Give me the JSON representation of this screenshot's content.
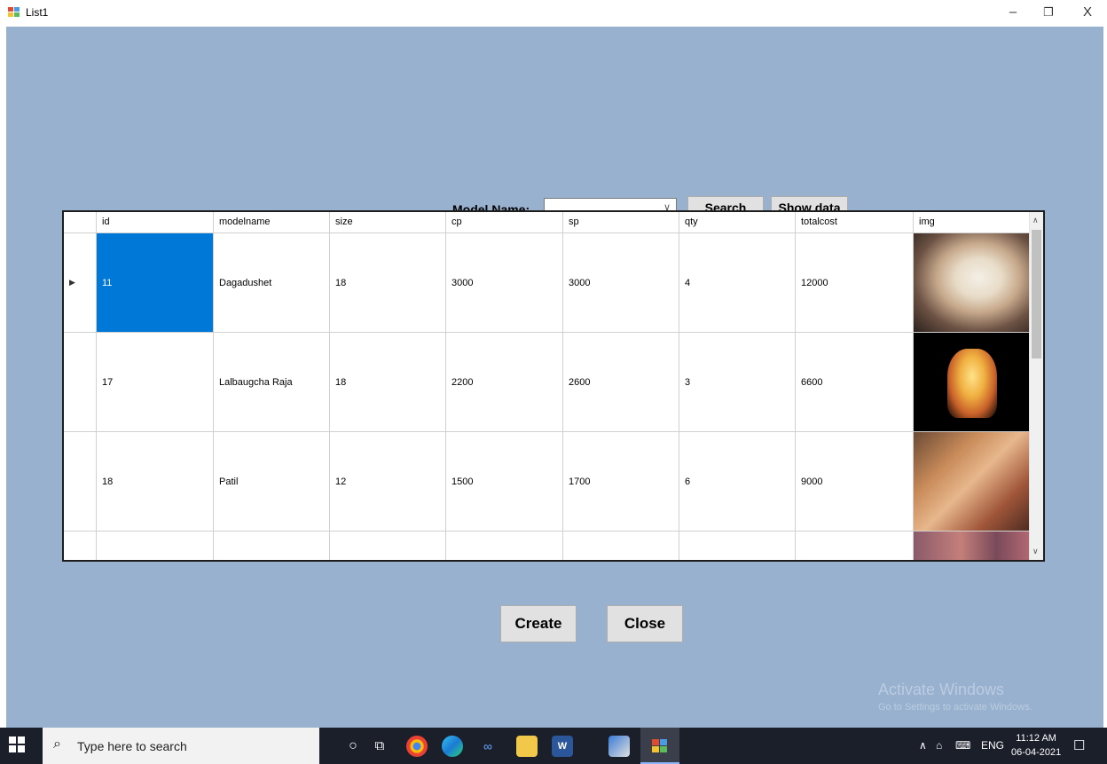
{
  "window": {
    "title": "List1",
    "minimize": "–",
    "restore": "❐",
    "close": "X"
  },
  "form": {
    "model_label": "Model Name:",
    "model_combo_value": "",
    "search_label": "Search",
    "show_data_label": "Show data",
    "create_label": "Create",
    "close_label": "Close"
  },
  "grid": {
    "columns": [
      "id",
      "modelname",
      "size",
      "cp",
      "sp",
      "qty",
      "totalcost",
      "img"
    ],
    "rows": [
      {
        "id": "11",
        "modelname": "Dagadushet",
        "size": "18",
        "cp": "3000",
        "sp": "3000",
        "qty": "4",
        "totalcost": "12000",
        "img": "ganesha-idol-image"
      },
      {
        "id": "17",
        "modelname": "Lalbaugcha Raja",
        "size": "18",
        "cp": "2200",
        "sp": "2600",
        "qty": "3",
        "totalcost": "6600",
        "img": "ganesha-idol-image"
      },
      {
        "id": "18",
        "modelname": "Patil",
        "size": "12",
        "cp": "1500",
        "sp": "1700",
        "qty": "6",
        "totalcost": "9000",
        "img": "ganesha-idol-image"
      }
    ],
    "selected_row": 0,
    "selected_column": "id"
  },
  "watermark": {
    "line1": "Activate Windows",
    "line2": "Go to Settings to activate Windows."
  },
  "taskbar": {
    "search_placeholder": "Type here to search",
    "tray_language": "ENG",
    "time": "11:12 AM",
    "date": "06-04-2021"
  },
  "colors": {
    "form_bg": "#97b1cf",
    "selection": "#0078d7",
    "taskbar": "#1b1f2a"
  }
}
